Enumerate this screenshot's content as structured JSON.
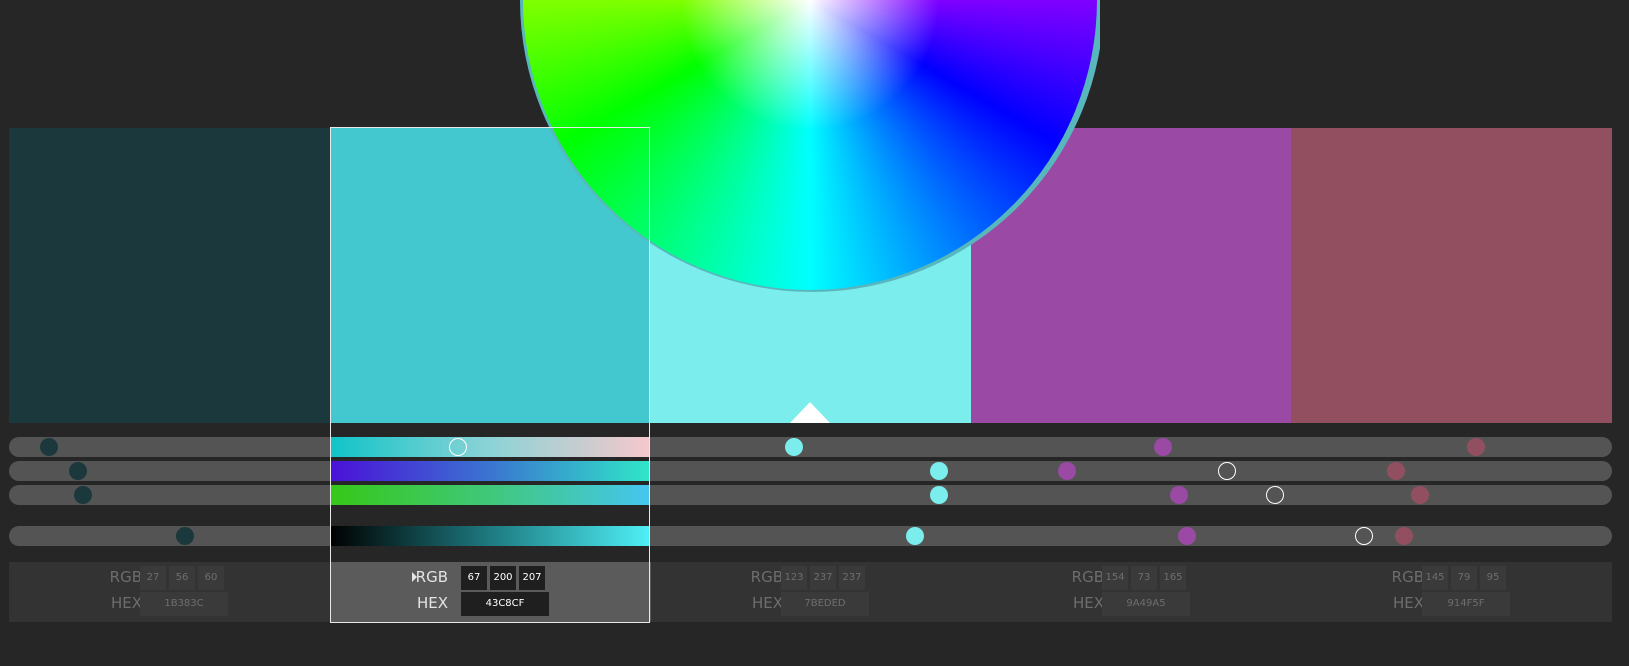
{
  "swatches": [
    {
      "id": "c1",
      "color": "#1B383C",
      "rgb": [
        "27",
        "56",
        "60"
      ],
      "hex": "1B383C"
    },
    {
      "id": "c2",
      "color": "#43C8CF",
      "rgb": [
        "67",
        "200",
        "207"
      ],
      "hex": "43C8CF"
    },
    {
      "id": "c3",
      "color": "#7BEDED",
      "rgb": [
        "123",
        "237",
        "237"
      ],
      "hex": "7BEDED"
    },
    {
      "id": "c4",
      "color": "#9A49A5",
      "rgb": [
        "154",
        "73",
        "165"
      ],
      "hex": "9A49A5"
    },
    {
      "id": "c5",
      "color": "#914F5F",
      "rgb": [
        "145",
        "79",
        "95"
      ],
      "hex": "914F5F"
    }
  ],
  "labels": {
    "rgb": "RGB",
    "hex": "HEX"
  },
  "selected_index": 1,
  "sliders": {
    "rows": [
      "hue",
      "saturation",
      "lightness",
      "brightness"
    ],
    "hue": [
      0.025,
      0.28,
      0.49,
      0.72,
      0.915
    ],
    "saturation": [
      0.043,
      0.76,
      0.58,
      0.66,
      0.865
    ],
    "lightness": [
      0.046,
      0.79,
      0.58,
      0.73,
      0.88
    ],
    "brightness": [
      0.11,
      0.845,
      0.565,
      0.735,
      0.87
    ]
  },
  "wheel_markers": [
    {
      "swatch": "c1",
      "color": "#1B383C"
    },
    {
      "swatch": "c2",
      "color": "#43C8CF"
    },
    {
      "swatch": "c3",
      "color": "#7BEDED"
    },
    {
      "swatch": "c4",
      "color": "#9A49A5"
    },
    {
      "swatch": "c5",
      "color": "#914F5F"
    }
  ]
}
